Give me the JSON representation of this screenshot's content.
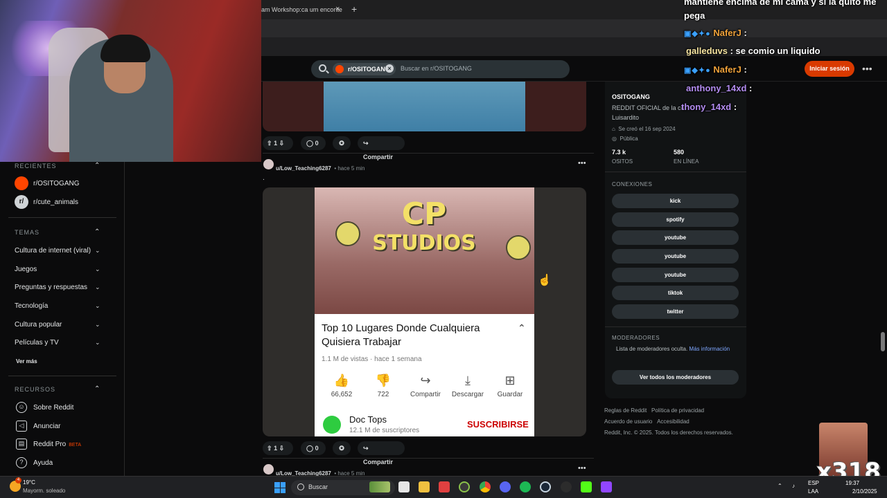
{
  "browser": {
    "tab_title": "am Workshop:ca um enconte",
    "tab_close": "×",
    "new_tab": "+"
  },
  "header": {
    "chip_label": "r/OSITOGANG",
    "search_placeholder": "Buscar en r/OSITOGANG",
    "login_label": "Iniciar sesión",
    "more": "•••"
  },
  "chat": {
    "line0": "mantiene encima de mi cama y si la quito me",
    "line0b": "pega",
    "messages": [
      {
        "user": "NaferJ",
        "text": ":",
        "badges": "▣◆✦●"
      },
      {
        "user": "galleduvs",
        "text": ": se comio un liquido"
      },
      {
        "user": "NaferJ",
        "text": ":",
        "badges": "▣◆✦●"
      },
      {
        "user": "anthony_14xd",
        "text": ":"
      },
      {
        "user": "thony_14xd",
        "text": ":"
      }
    ]
  },
  "sidebar": {
    "recientes": "RECIENTES",
    "recent": [
      {
        "label": "r/OSITOGANG"
      },
      {
        "label": "r/cute_animals"
      }
    ],
    "temas": "TEMAS",
    "topics": [
      {
        "label": "Cultura de internet (viral)"
      },
      {
        "label": "Juegos"
      },
      {
        "label": "Preguntas y respuestas"
      },
      {
        "label": "Tecnología"
      },
      {
        "label": "Cultura popular"
      },
      {
        "label": "Películas y TV"
      }
    ],
    "ver_mas": "Ver más",
    "recursos": "RECURSOS",
    "resources": [
      {
        "label": "Sobre Reddit"
      },
      {
        "label": "Anunciar"
      },
      {
        "label": "Reddit Pro",
        "badge": "BETA"
      },
      {
        "label": "Ayuda"
      }
    ]
  },
  "feed": {
    "post1": {
      "votes": "1",
      "comments": "0",
      "share": "Compartir"
    },
    "post2": {
      "author": "u/Low_Teaching6287",
      "time": "• hace 5 min",
      "body": ".",
      "votes": "1",
      "comments": "0",
      "share": "Compartir"
    },
    "post3": {
      "author": "u/Low_Teaching6287",
      "time": "• hace 5 min"
    },
    "video": {
      "sign_top": "CP",
      "sign_bottom": "STUDIOS",
      "title": "Top 10 Lugares Donde Cualquiera Quisiera Trabajar",
      "meta": "1.1 M de vistas · hace 1 semana",
      "buttons": [
        {
          "icon": "👍",
          "label": "66,652"
        },
        {
          "icon": "👎",
          "label": "722"
        },
        {
          "icon": "↪",
          "label": "Compartir"
        },
        {
          "icon": "⤓",
          "label": "Descargar"
        },
        {
          "icon": "⊞",
          "label": "Guardar"
        }
      ],
      "channel": "Doc Tops",
      "subs": "12.1 M de suscriptores",
      "subscribe": "SUSCRIBIRSE"
    }
  },
  "community": {
    "name": "OSITOGANG",
    "desc": "REDDIT OFICIAL de la co",
    "desc2": "Luisardito",
    "created": "Se creó el 16 sep 2024",
    "visibility": "Pública",
    "members_num": "7.3 k",
    "members_lbl": "OSITOS",
    "online_num": "580",
    "online_lbl": "EN LÍNEA",
    "connections_head": "CONEXIONES",
    "links": [
      "kick",
      "spotify",
      "youtube",
      "youtube",
      "youtube",
      "tiktok",
      "twitter"
    ],
    "mods_head": "MODERADORES",
    "mods_text": "Lista de moderadores oculta.",
    "mods_link": "Más información",
    "mods_btn": "Ver todos los moderadores"
  },
  "footer": {
    "rules": "Reglas de Reddit",
    "privacy": "Política de privacidad",
    "agreement": "Acuerdo de usuario",
    "access": "Accesibilidad",
    "copyright": "Reddit, Inc. © 2025. Todos los derechos reservados."
  },
  "overlay": {
    "emote_count": "x318"
  },
  "taskbar": {
    "weather_temp": "19°C",
    "weather_desc": "Mayorm. soleado",
    "weather_badge": "4",
    "search": "Buscar",
    "lang1": "ESP",
    "lang2": "LAA",
    "time": "19:37",
    "date": "2/10/2025"
  },
  "colors": {
    "accent": "#d93a00",
    "reddit_orange": "#ff4500"
  }
}
